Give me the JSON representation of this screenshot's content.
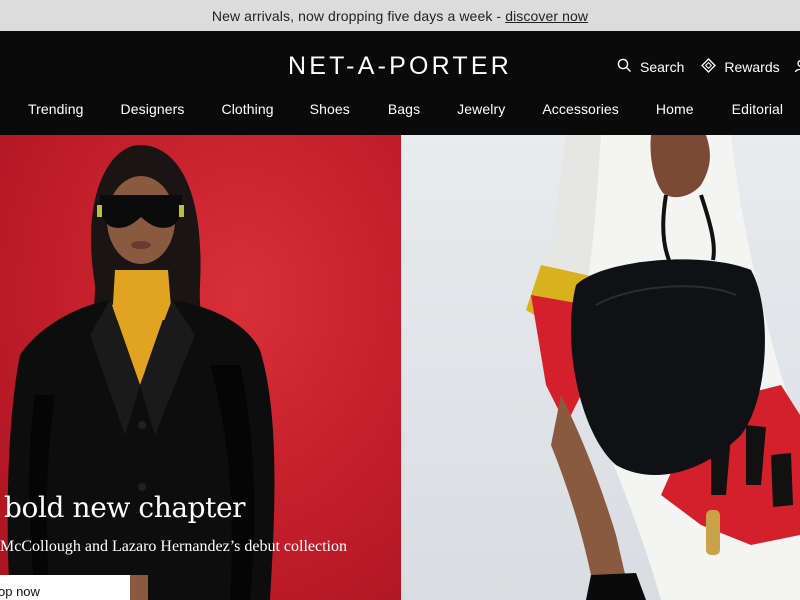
{
  "promo": {
    "text": "New arrivals, now dropping five days a week -",
    "link": "discover now"
  },
  "header": {
    "logo": "NET-A-PORTER",
    "utility": {
      "search_label": "Search",
      "rewards_label": "Rewards"
    },
    "nav": [
      {
        "label": "Trending"
      },
      {
        "label": "Designers"
      },
      {
        "label": "Clothing"
      },
      {
        "label": "Shoes"
      },
      {
        "label": "Bags"
      },
      {
        "label": "Jewelry"
      },
      {
        "label": "Accessories"
      },
      {
        "label": "Home"
      },
      {
        "label": "Editorial"
      }
    ]
  },
  "hero": {
    "title": "bold new chapter",
    "subtitle": "McCollough and Lazaro Hernandez’s debut collection",
    "cta_label": "op now"
  },
  "colors": {
    "header_bg": "#0a0a0a",
    "promo_bg": "#dcdcdc",
    "hero_left_bg": "#c6202d",
    "hero_right_bg": "#e3e6ea"
  }
}
